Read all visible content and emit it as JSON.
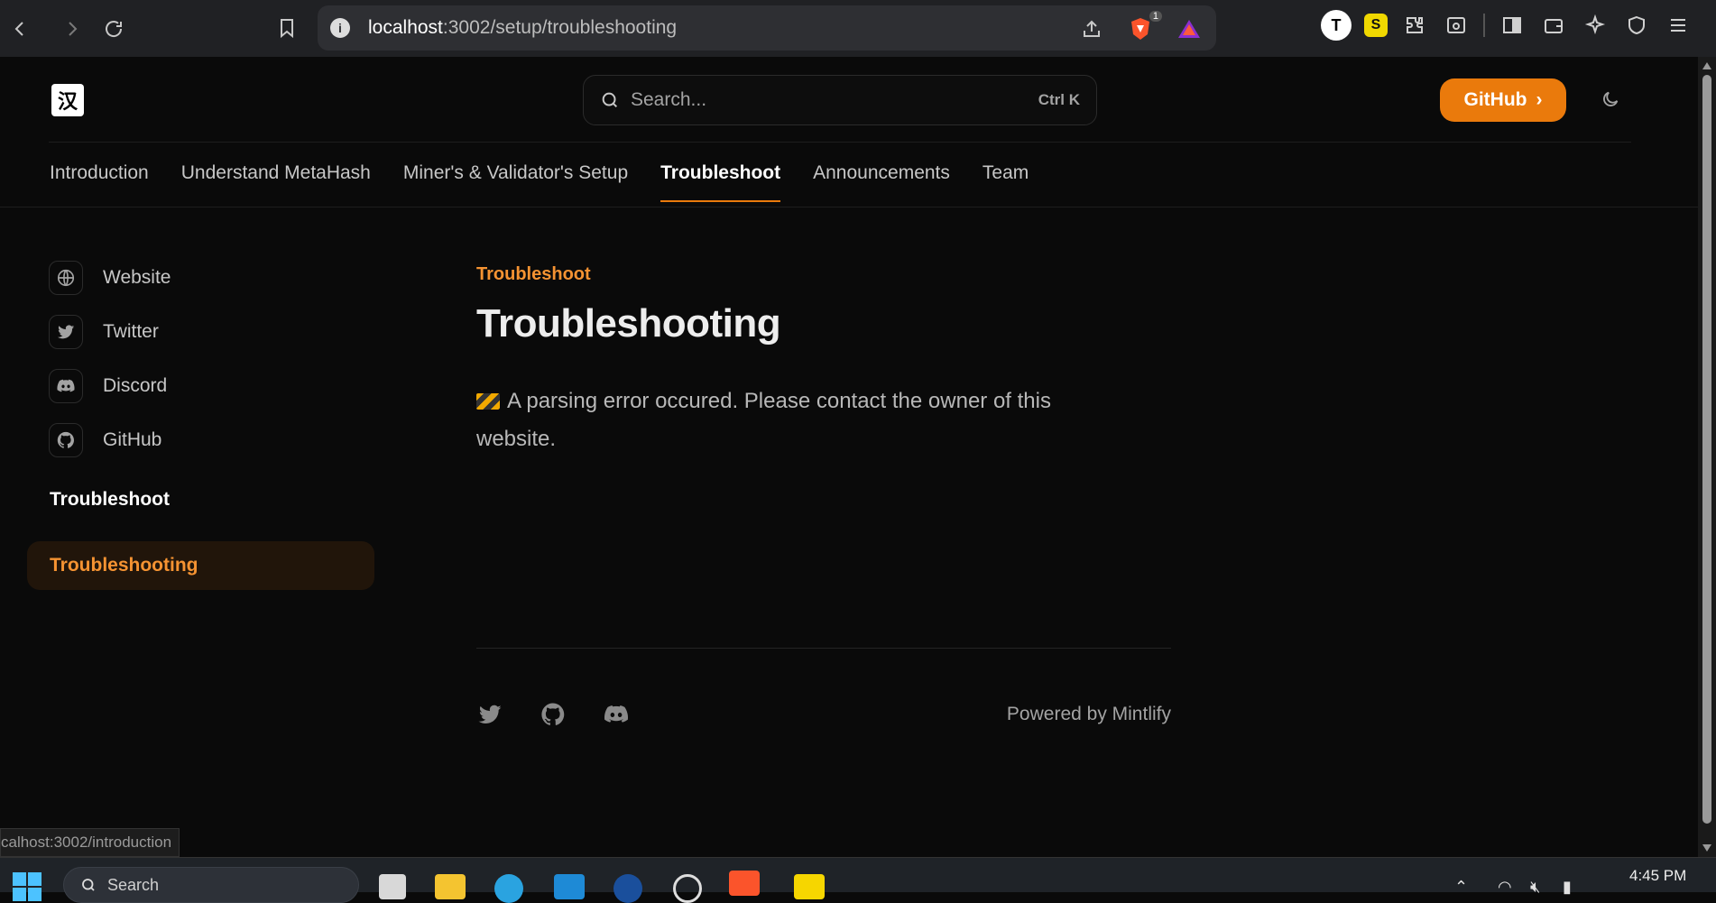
{
  "browser": {
    "url_host": "localhost",
    "url_path": ":3002/setup/troubleshooting",
    "badge_count": "1",
    "profile_initial": "T",
    "ext_yellow_letter": "S"
  },
  "header": {
    "logo_glyph": "汉",
    "search_placeholder": "Search...",
    "search_shortcut": "Ctrl K",
    "github_label": "GitHub",
    "github_chevron": "›"
  },
  "tabs": [
    {
      "label": "Introduction"
    },
    {
      "label": "Understand MetaHash"
    },
    {
      "label": "Miner's & Validator's Setup"
    },
    {
      "label": "Troubleshoot"
    },
    {
      "label": "Announcements"
    },
    {
      "label": "Team"
    }
  ],
  "sidebar": {
    "links": [
      {
        "label": "Website",
        "icon": "globe-icon"
      },
      {
        "label": "Twitter",
        "icon": "twitter-icon"
      },
      {
        "label": "Discord",
        "icon": "discord-icon"
      },
      {
        "label": "GitHub",
        "icon": "github-icon"
      }
    ],
    "section_title": "Troubleshoot",
    "active_item": "Troubleshooting"
  },
  "content": {
    "eyebrow": "Troubleshoot",
    "title": "Troubleshooting",
    "message": "A parsing error occured. Please contact the owner of this website."
  },
  "footer": {
    "powered_by": "Powered by Mintlify"
  },
  "status_bar_url": "calhost:3002/introduction",
  "taskbar": {
    "search_placeholder": "Search",
    "time": "4:45 PM"
  },
  "colors": {
    "accent": "#ea7a0c",
    "accent_text": "#f59332",
    "background": "#0a0a0a"
  }
}
